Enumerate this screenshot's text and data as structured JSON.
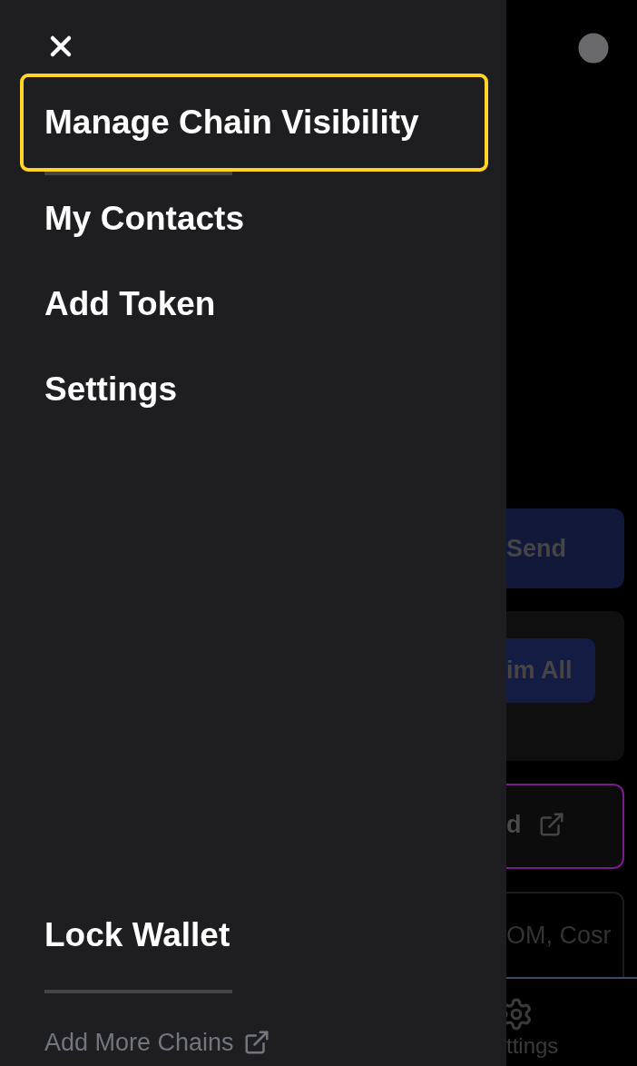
{
  "drawer": {
    "menu_items": [
      {
        "label": "Manage Chain Visibility",
        "highlighted": true
      },
      {
        "label": "My Contacts",
        "highlighted": false
      },
      {
        "label": "Add Token",
        "highlighted": false
      },
      {
        "label": "Settings",
        "highlighted": false
      }
    ],
    "lock": {
      "label": "Lock Wallet"
    },
    "footer_link": {
      "label": "Add More Chains"
    }
  },
  "background": {
    "send_button": "Send",
    "claim_button": "im All",
    "promo_card": "d",
    "assets_card": "OM, Cosr",
    "nav_item": "ttings"
  }
}
